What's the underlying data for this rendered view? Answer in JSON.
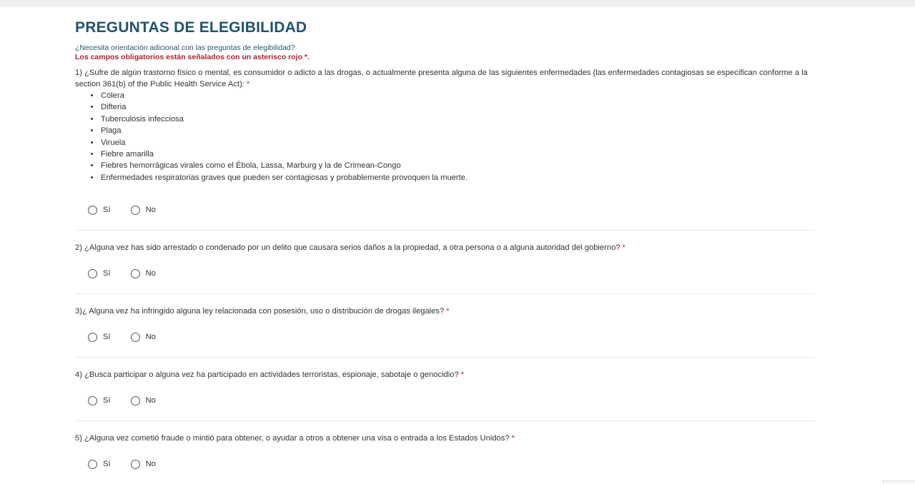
{
  "form": {
    "title": "PREGUNTAS DE ELEGIBILIDAD",
    "guidance_link": "¿Necesita orientación adicional con las preguntas de elegibilidad?",
    "required_note": "Los campos obligatorios están señalados con un asterisco rojo *.",
    "required_marker": "*",
    "colors": {
      "title": "#1f5470",
      "required": "#b21f2d",
      "divider": "#e8e8e8"
    }
  },
  "questions": [
    {
      "text": "1) ¿Sufre de algún trastorno físico o mental, es consumidor o adicto a las drogas, o actualmente presenta alguna de las siguientes enfermedades (las enfermedades contagiosas se especifican conforme a la section 361(b) of the Public Health Service Act):",
      "list": [
        "Cólera",
        "Difteria",
        "Tuberculosis infecciosa",
        "Plaga",
        "Viruela",
        "Fiebre amarilla",
        "Fiebres hemorrágicas virales como el Ébola, Lassa, Marburg y la de Crimean-Congo",
        "Enfermedades respiratorias graves que pueden ser contagiosas y probablemente provoquen la muerte."
      ],
      "option_yes": "Sí",
      "option_no": "No"
    },
    {
      "text": "2) ¿Alguna vez has sido arrestado o condenado por un delito que causara serios daños a la propiedad, a otra persona o a alguna autoridad del gobierno?",
      "option_yes": "Sí",
      "option_no": "No"
    },
    {
      "text": "3)¿ Alguna vez ha infringido alguna ley relacionada con posesión, uso o distribución de drogas ilegales?",
      "option_yes": "Sí",
      "option_no": "No"
    },
    {
      "text": "4) ¿Busca participar o alguna vez ha participado en actividades terroristas, espionaje, sabotaje o genocidio?",
      "option_yes": "Sí",
      "option_no": "No"
    },
    {
      "text": "5) ¿Alguna vez cometió fraude o mintió para obtener, o ayudar a otros a obtener una visa o entrada a los Estados Unidos?",
      "option_yes": "Sí",
      "option_no": "No"
    }
  ]
}
